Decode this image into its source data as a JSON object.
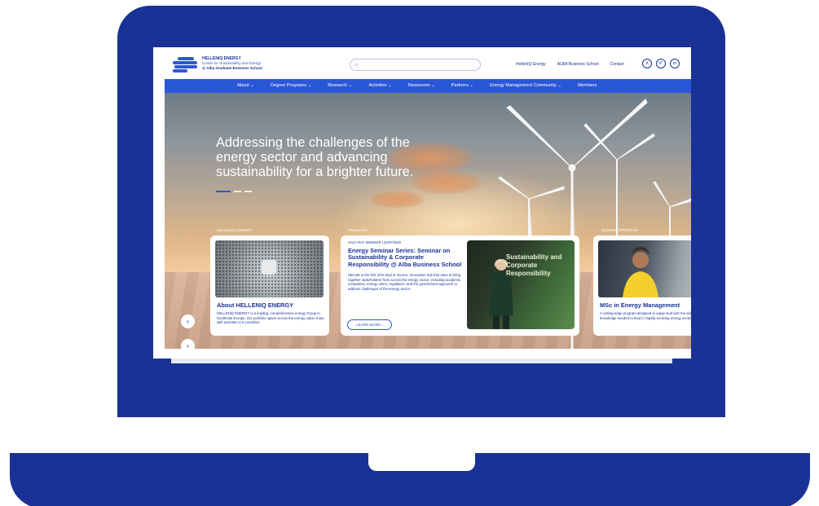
{
  "header": {
    "logo_line1": "HELLENiQ ENERGY",
    "logo_line2": "Center for Sustainability and Energy",
    "logo_line3": "@ Alba Graduate Business School",
    "search_placeholder": "",
    "links": [
      "HellenIQ Energy",
      "ALBA Business School",
      "Contact"
    ],
    "social": [
      {
        "icon": "x-icon",
        "glyph": "X"
      },
      {
        "icon": "pinterest-icon",
        "glyph": "P"
      },
      {
        "icon": "linkedin-icon",
        "glyph": "in"
      }
    ]
  },
  "nav": {
    "items": [
      "About ⌄",
      "Degree Programs ⌄",
      "Research ⌄",
      "Activities ⌄",
      "Newsroom ⌄",
      "Partners ⌄",
      "Energy Management Community ⌄",
      "Members"
    ]
  },
  "hero": {
    "headline": "Addressing the challenges of the energy sector and advancing sustainability for a brighter future.",
    "slide_index": 1,
    "slide_count": 3
  },
  "sections": {
    "left": "HELLENIQ ENERGY",
    "middle": "SEMINARS",
    "right": "DEGREE PROGRAM"
  },
  "cards": {
    "card1": {
      "title": "About HELLENIQ ENERGY",
      "text": "HELLENiQ ENERGY is a leading, comprehensive energy Group in Southeast Europe. Our portfolio spans across the energy value chain, with activities in 6 countries."
    },
    "card2": {
      "meta": "HALF-DAY SEMINAR | 22/07/2025",
      "title": "Energy Seminar Series: Seminar on Sustainability & Corporate Responsibility @ Alba Business School",
      "text": "HECSE is the first of its kind in Greece, innovation hub that aims to bring together stakeholders from across the energy sector, including academic, companies, energy users, regulators, and the government approach to address challenges of the energy sector.",
      "button": "LEARN MORE ›",
      "image_text": "Sustainability and Corporate Responsibility"
    },
    "card3": {
      "title": "MSc in Energy Management",
      "text": "A cutting-edge program designed to equip stud with the skills and knowledge needed to lead in rapidly evolving energy sector."
    }
  },
  "carousel": {
    "next": "›",
    "prev": "‹"
  },
  "colors": {
    "brand_blue": "#1a3296",
    "nav_blue": "#2a57d8"
  }
}
